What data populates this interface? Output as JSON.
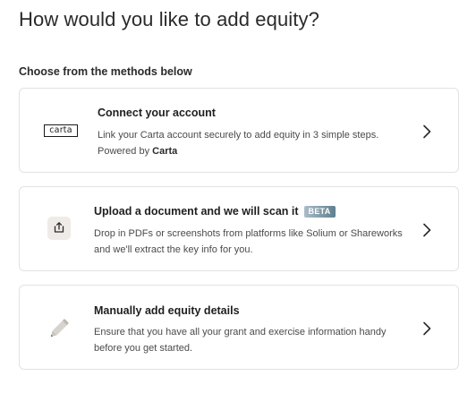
{
  "page": {
    "title": "How would you like to add equity?",
    "section_label": "Choose from the methods below"
  },
  "methods": [
    {
      "icon": "carta-logo",
      "logo_text": "carta",
      "title": "Connect your account",
      "description": "Link your Carta account securely to add equity in 3 simple steps.",
      "powered_prefix": "Powered by ",
      "powered_brand": "Carta"
    },
    {
      "icon": "upload-icon",
      "title": "Upload a document and we will scan it",
      "badge": "BETA",
      "description": "Drop in PDFs or screenshots from platforms like Solium or Shareworks and we'll extract the key info for you."
    },
    {
      "icon": "pencil-icon",
      "title": "Manually add equity details",
      "description": "Ensure that you have all your grant and exercise information handy before you get started."
    }
  ],
  "colors": {
    "card_border": "#e2e2e2",
    "badge_start": "#a9bcc8",
    "badge_end": "#5f7f8f",
    "upload_tile": "#efebe6",
    "text_primary": "#1f1f1f",
    "text_secondary": "#4a4a4a"
  }
}
